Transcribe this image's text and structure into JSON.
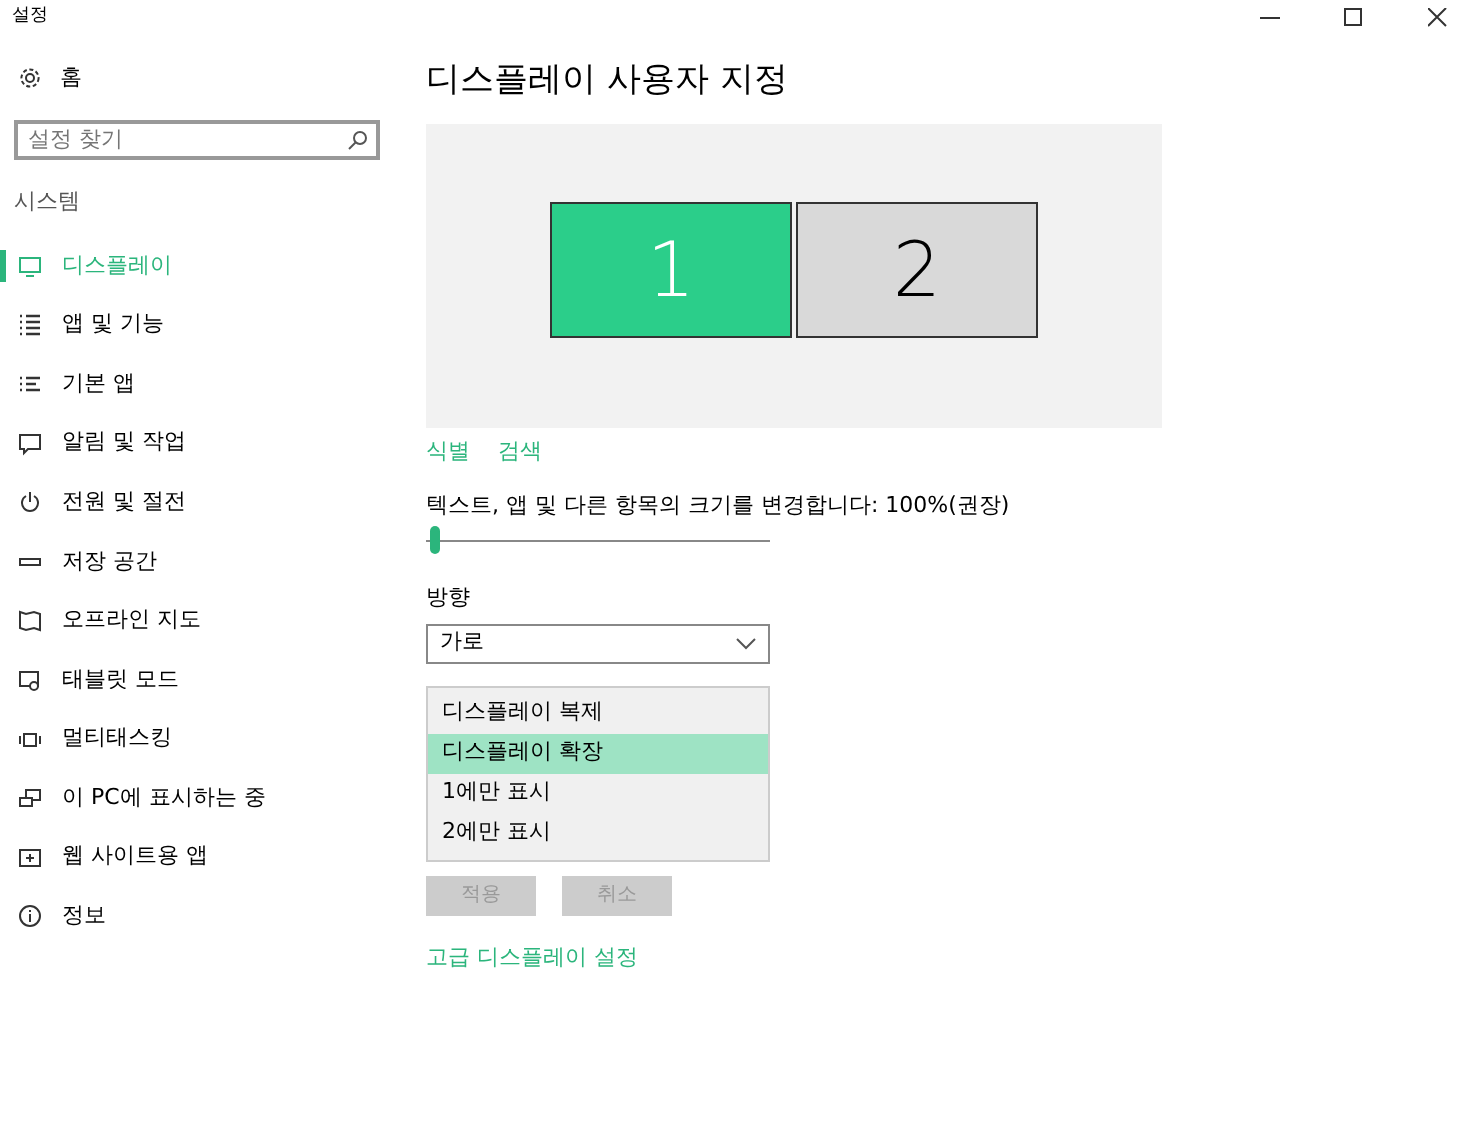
{
  "window": {
    "title": "설정"
  },
  "sidebar": {
    "home": "홈",
    "search": {
      "placeholder": "설정 찾기"
    },
    "section": "시스템",
    "items": [
      {
        "label": "디스플레이",
        "selected": true
      },
      {
        "label": "앱 및 기능",
        "selected": false
      },
      {
        "label": "기본 앱",
        "selected": false
      },
      {
        "label": "알림 및 작업",
        "selected": false
      },
      {
        "label": "전원 및 절전",
        "selected": false
      },
      {
        "label": "저장 공간",
        "selected": false
      },
      {
        "label": "오프라인 지도",
        "selected": false
      },
      {
        "label": "태블릿 모드",
        "selected": false
      },
      {
        "label": "멀티태스킹",
        "selected": false
      },
      {
        "label": "이 PC에 표시하는 중",
        "selected": false
      },
      {
        "label": "웹 사이트용 앱",
        "selected": false
      },
      {
        "label": "정보",
        "selected": false
      }
    ]
  },
  "main": {
    "title": "디스플레이 사용자 지정",
    "monitors": [
      {
        "label": "1",
        "selected": true
      },
      {
        "label": "2",
        "selected": false
      }
    ],
    "links": [
      "식별",
      "검색"
    ],
    "scale": {
      "label": "텍스트, 앱 및 다른 항목의 크기를 변경합니다: 100%(권장)",
      "level": 0.01
    },
    "orientation": {
      "label": "방향",
      "value": "가로"
    },
    "multiple_displays": [
      {
        "label": "디스플레이 복제",
        "selected": false
      },
      {
        "label": "디스플레이 확장",
        "selected": true
      },
      {
        "label": "1에만 표시",
        "selected": false
      },
      {
        "label": "2에만 표시",
        "selected": false
      }
    ],
    "buttons": [
      {
        "label": "적용",
        "disabled": true
      },
      {
        "label": "취소",
        "disabled": true
      }
    ],
    "advanced_link": "고급 디스플레이 설정"
  }
}
